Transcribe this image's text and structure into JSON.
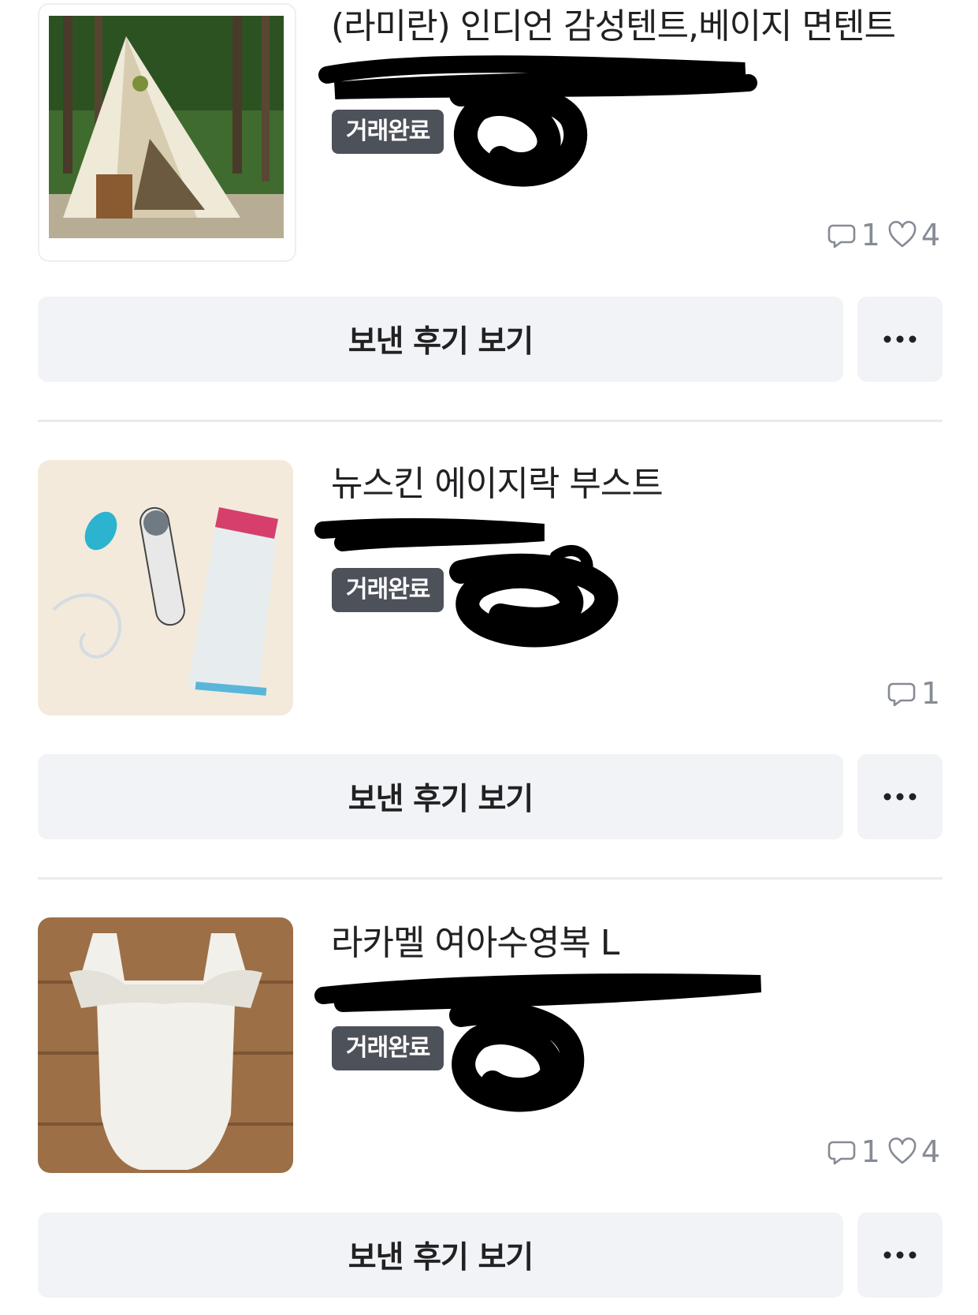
{
  "items": [
    {
      "title": "(라미란) 인디언 감성텐트,베이지 면텐트",
      "status_badge": "거래완료",
      "chat_count": "1",
      "like_count": "4",
      "review_button": "보낸 후기 보기"
    },
    {
      "title": "뉴스킨 에이지락 부스트",
      "status_badge": "거래완료",
      "chat_count": "1",
      "review_button": "보낸 후기 보기"
    },
    {
      "title": "라카멜 여아수영복 L",
      "status_badge": "거래완료",
      "chat_count": "1",
      "like_count": "4",
      "review_button": "보낸 후기 보기"
    }
  ],
  "icons": {
    "chat": "chat-bubble-icon",
    "like": "heart-icon",
    "more": "more-dots-icon"
  },
  "colors": {
    "badge_bg": "#4d5159",
    "button_bg": "#f2f3f6",
    "meta_text": "#868b94",
    "divider": "#eaebee"
  }
}
